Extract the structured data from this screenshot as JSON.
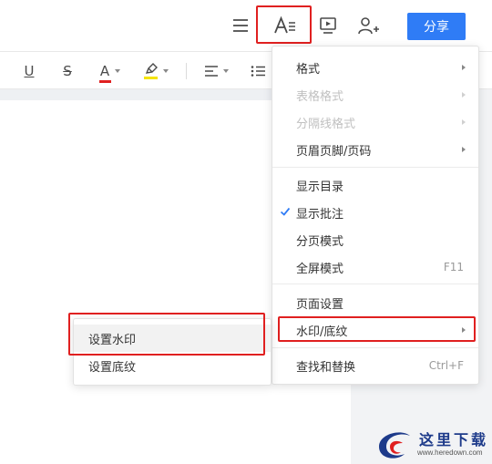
{
  "topbar": {
    "share_label": "分享",
    "icons": [
      "menu-icon",
      "text-format-icon",
      "present-icon",
      "add-user-icon"
    ]
  },
  "toolbar": {
    "icons": [
      "underline-icon",
      "strikethrough-icon",
      "font-color-icon",
      "highlight-icon",
      "align-icon",
      "list-icon"
    ],
    "font_color_label": "A",
    "underline_label": "U",
    "strike_label": "S",
    "font_color_accent": "#e02020",
    "highlight_accent": "#f5e400"
  },
  "menu": {
    "items": [
      {
        "label": "格式",
        "enabled": true,
        "submenu": true
      },
      {
        "label": "表格格式",
        "enabled": false,
        "submenu": true
      },
      {
        "label": "分隔线格式",
        "enabled": false,
        "submenu": true
      },
      {
        "label": "页眉页脚/页码",
        "enabled": true,
        "submenu": true
      },
      {
        "label": "显示目录",
        "enabled": true
      },
      {
        "label": "显示批注",
        "enabled": true,
        "checked": true
      },
      {
        "label": "分页模式",
        "enabled": true
      },
      {
        "label": "全屏模式",
        "enabled": true,
        "shortcut": "F11"
      },
      {
        "label": "页面设置",
        "enabled": true
      },
      {
        "label": "水印/底纹",
        "enabled": true,
        "submenu": true,
        "highlighted": true
      },
      {
        "label": "查找和替换",
        "enabled": true,
        "shortcut": "Ctrl+F"
      }
    ]
  },
  "submenu": {
    "items": [
      {
        "label": "设置水印",
        "hover": true
      },
      {
        "label": "设置底纹"
      }
    ]
  },
  "colors": {
    "accent": "#2f7cf6",
    "highlight_box": "#e02020",
    "check": "#2f7cf6"
  },
  "watermark": {
    "text": "这里下载",
    "url": "www.heredown.com"
  }
}
